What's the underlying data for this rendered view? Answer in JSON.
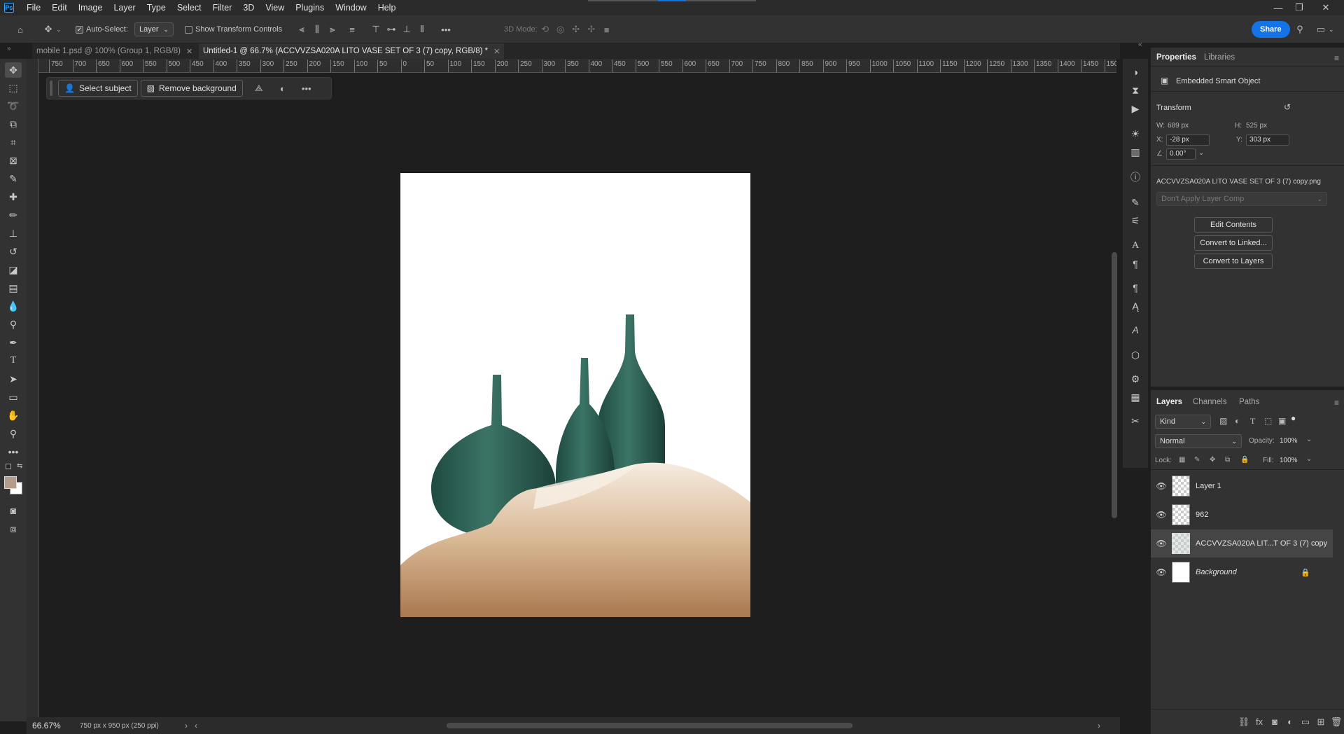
{
  "app": {
    "logo": "Ps"
  },
  "menu": [
    "File",
    "Edit",
    "Image",
    "Layer",
    "Type",
    "Select",
    "Filter",
    "3D",
    "View",
    "Plugins",
    "Window",
    "Help"
  ],
  "options": {
    "auto_select_label": "Auto-Select:",
    "auto_select_target": "Layer",
    "show_transform_label": "Show Transform Controls",
    "mode_3d_label": "3D Mode:",
    "share_label": "Share"
  },
  "tabs": [
    {
      "label": "mobile 1.psd @ 100% (Group 1, RGB/8)"
    },
    {
      "label": "Untitled-1 @ 66.7% (ACCVVZSA020A LITO VASE SET OF 3 (7) copy, RGB/8) *"
    }
  ],
  "ruler": {
    "top_labels": [
      "750",
      "700",
      "650",
      "600",
      "550",
      "500",
      "450",
      "400",
      "350",
      "300",
      "250",
      "200",
      "150",
      "100",
      "50",
      "0",
      "50",
      "100",
      "150",
      "200",
      "250",
      "300",
      "350",
      "400",
      "450",
      "500",
      "550",
      "600",
      "650",
      "700",
      "750",
      "800",
      "850",
      "900",
      "950",
      "1000",
      "1050",
      "1100",
      "1150",
      "1200",
      "1250",
      "1300",
      "1350",
      "1400",
      "1450",
      "150"
    ]
  },
  "contextual_bar": {
    "select_subject": "Select subject",
    "remove_background": "Remove background"
  },
  "properties": {
    "tab_properties": "Properties",
    "tab_libraries": "Libraries",
    "object_type": "Embedded Smart Object",
    "transform_title": "Transform",
    "w_label": "W:",
    "w_value": "689 px",
    "h_label": "H:",
    "h_value": "525 px",
    "x_label": "X:",
    "x_value": "-28 px",
    "y_label": "Y:",
    "y_value": "303 px",
    "angle_value": "0.00°",
    "filename": "ACCVVZSA020A LITO VASE SET OF 3 (7) copy.png",
    "layer_comp": "Don't Apply Layer Comp",
    "edit_contents": "Edit Contents",
    "convert_linked": "Convert to Linked...",
    "convert_layers": "Convert to Layers"
  },
  "layers_panel": {
    "tab_layers": "Layers",
    "tab_channels": "Channels",
    "tab_paths": "Paths",
    "kind_label": "Kind",
    "blend_mode": "Normal",
    "opacity_label": "Opacity:",
    "opacity_value": "100%",
    "lock_label": "Lock:",
    "fill_label": "Fill:",
    "fill_value": "100%",
    "layers": [
      {
        "name": "Layer 1"
      },
      {
        "name": "962"
      },
      {
        "name": "ACCVVZSA020A LIT...T OF 3 (7) copy"
      },
      {
        "name": "Background"
      }
    ]
  },
  "status": {
    "zoom": "66.67%",
    "doc_info": "750 px x 950 px (250 ppi)"
  },
  "colors": {
    "accent": "#1473e6",
    "vase": "#2f5f55",
    "fabric": "#c9a27a"
  }
}
